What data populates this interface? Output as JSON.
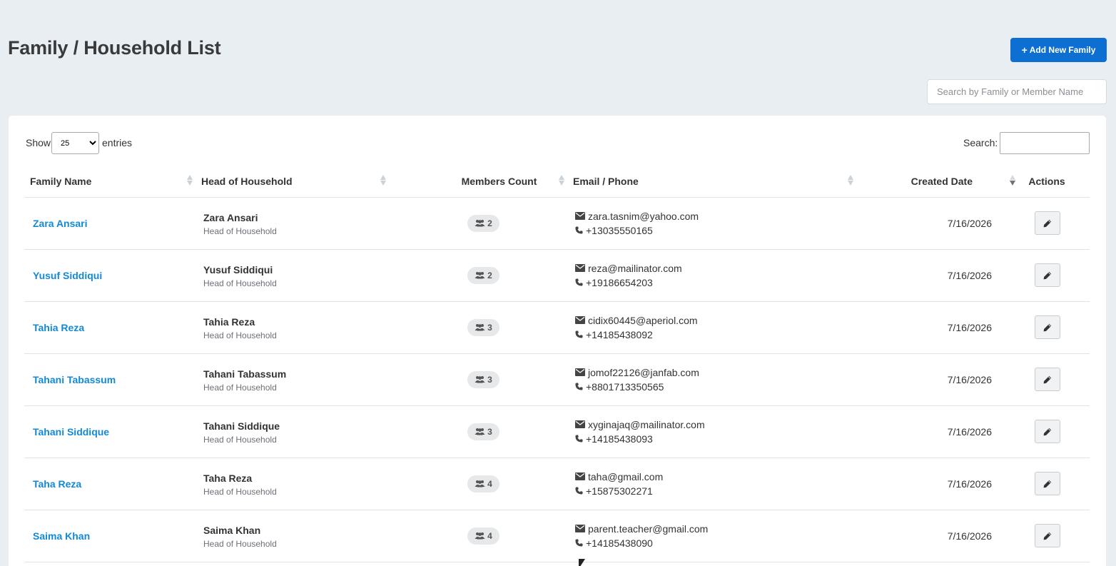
{
  "page": {
    "title": "Family / Household List",
    "add_button_label": "Add New Family",
    "top_search_placeholder": "Search by Family or Member Name"
  },
  "table_controls": {
    "show_label": "Show",
    "entries_label": "entries",
    "page_length": "25",
    "filter_label": "Search:"
  },
  "columns": {
    "family_name": "Family Name",
    "head": "Head of Household",
    "members": "Members Count",
    "contact": "Email / Phone",
    "created": "Created Date",
    "actions": "Actions"
  },
  "rows": [
    {
      "family": "Zara Ansari",
      "head_name": "Zara Ansari",
      "head_role": "Head of Household",
      "members": "2",
      "email": "zara.tasnim@yahoo.com",
      "phone": "+13035550165",
      "created": "7/16/2026"
    },
    {
      "family": "Yusuf Siddiqui",
      "head_name": "Yusuf Siddiqui",
      "head_role": "Head of Household",
      "members": "2",
      "email": "reza@mailinator.com",
      "phone": "+19186654203",
      "created": "7/16/2026"
    },
    {
      "family": "Tahia Reza",
      "head_name": "Tahia Reza",
      "head_role": "Head of Household",
      "members": "3",
      "email": "cidix60445@aperiol.com",
      "phone": "+14185438092",
      "created": "7/16/2026"
    },
    {
      "family": "Tahani Tabassum",
      "head_name": "Tahani Tabassum",
      "head_role": "Head of Household",
      "members": "3",
      "email": "jomof22126@janfab.com",
      "phone": "+8801713350565",
      "created": "7/16/2026"
    },
    {
      "family": "Tahani Siddique",
      "head_name": "Tahani Siddique",
      "head_role": "Head of Household",
      "members": "3",
      "email": "xyginajaq@mailinator.com",
      "phone": "+14185438093",
      "created": "7/16/2026"
    },
    {
      "family": "Taha Reza",
      "head_name": "Taha Reza",
      "head_role": "Head of Household",
      "members": "4",
      "email": "taha@gmail.com",
      "phone": "+15875302271",
      "created": "7/16/2026"
    },
    {
      "family": "Saima Khan",
      "head_name": "Saima Khan",
      "head_role": "Head of Household",
      "members": "4",
      "email": "parent.teacher@gmail.com",
      "phone": "+14185438090",
      "created": "7/16/2026"
    }
  ],
  "colors": {
    "background": "#e9eef3",
    "primary_button": "#0d6fd1",
    "link": "#1389d6"
  }
}
